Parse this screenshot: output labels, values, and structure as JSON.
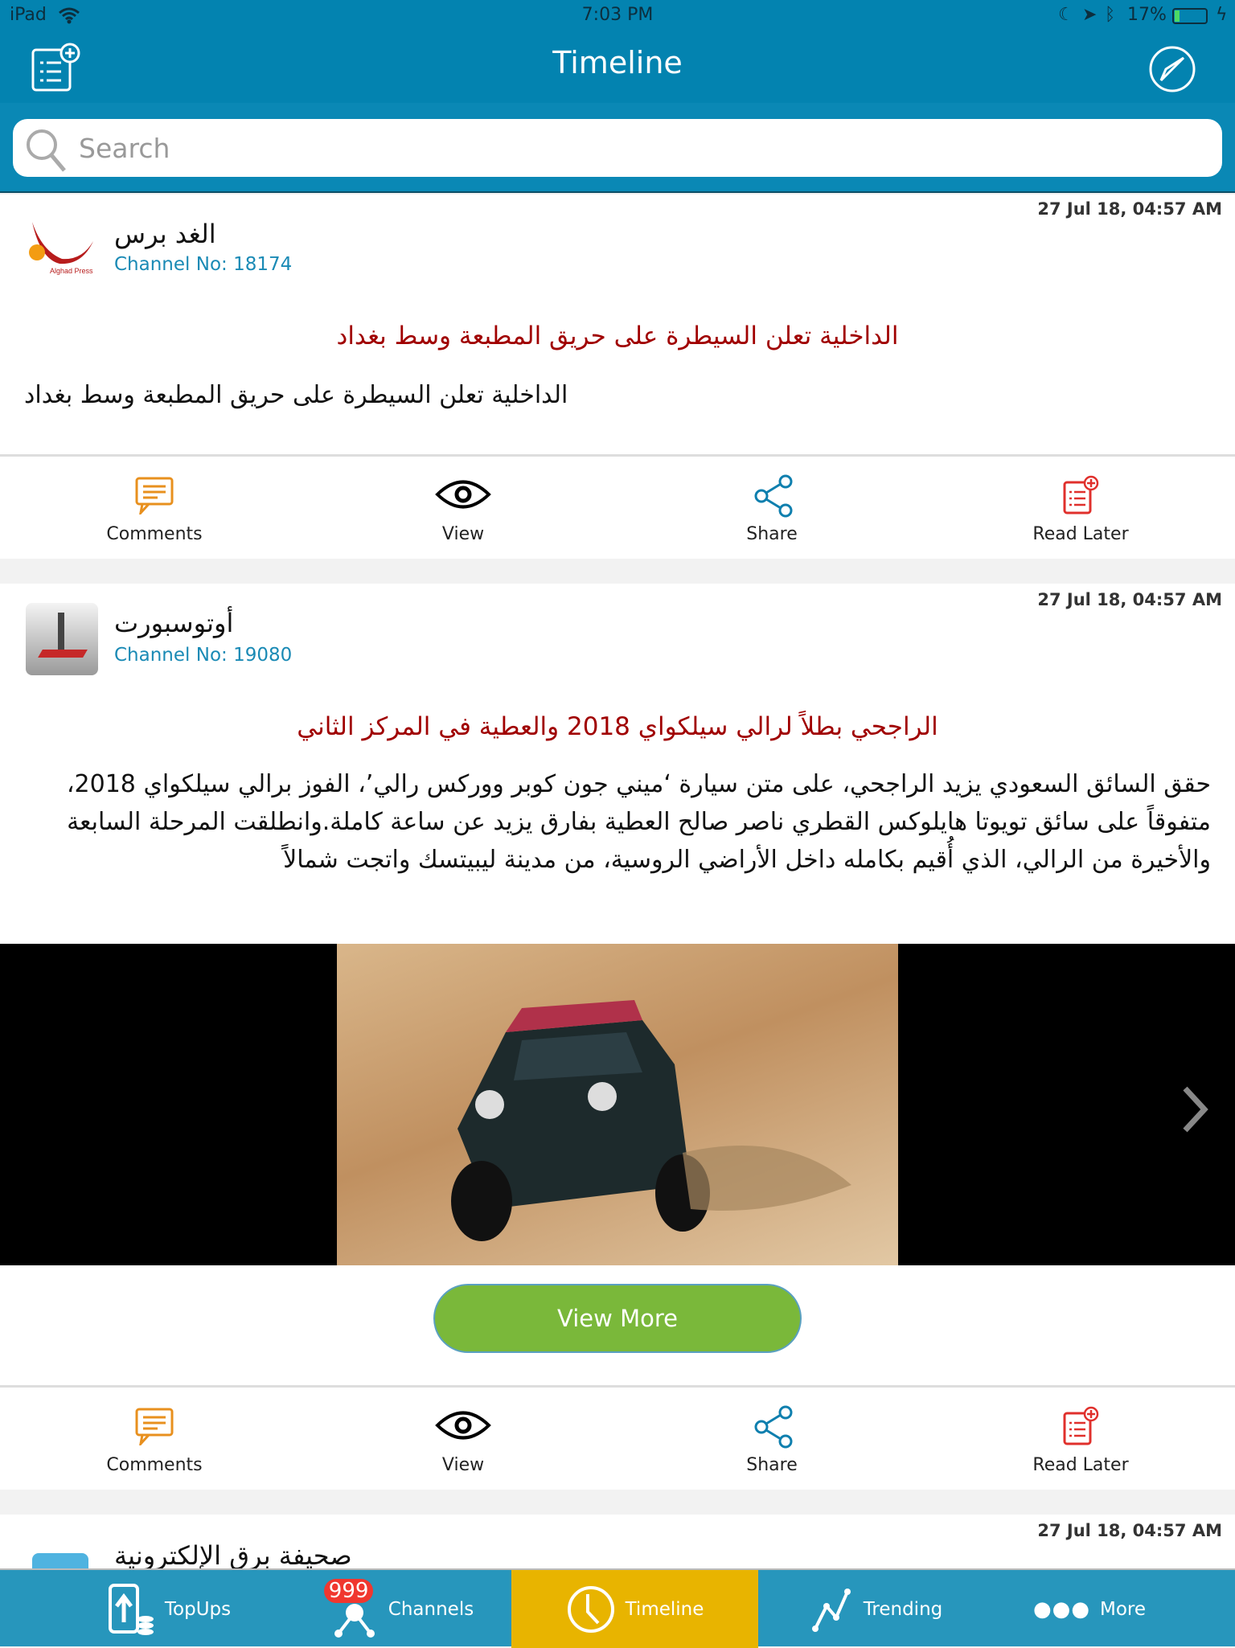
{
  "status_bar": {
    "device": "iPad",
    "time": "7:03 PM",
    "battery": "17%"
  },
  "nav": {
    "title": "Timeline",
    "left_icon": "read-later-list-icon",
    "right_icon": "compass-icon"
  },
  "search": {
    "placeholder": "Search"
  },
  "colors": {
    "nav": "#0383b0",
    "tabbar": "#2796bc",
    "active_tab": "#e8b400",
    "title_red": "#a00000",
    "channel_blue": "#1a8ab5",
    "view_more": "#7ab83a"
  },
  "posts": [
    {
      "timestamp": "27 Jul 18, 04:57 AM",
      "channel_name": "الغد برس",
      "channel_no": "Channel No: 18174",
      "logo_text": "Alghad Press",
      "title": "الداخلية تعلن السيطرة على حريق المطبعة وسط بغداد",
      "body": "الداخلية تعلن السيطرة على حريق المطبعة وسط بغداد"
    },
    {
      "timestamp": "27 Jul 18, 04:57 AM",
      "channel_name": "أوتوسبورت",
      "channel_no": "Channel No: 19080",
      "title": "الراجحي بطلاً لرالي سيلكواي 2018 والعطية في المركز الثاني",
      "body": "حقق السائق السعودي يزيد الراجحي، على متن سيارة ‘ميني جون كوبر ووركس رالي’، الفوز برالي سيلكواي 2018، متفوقاً على سائق تويوتا هايلوكس القطري ناصر صالح العطية بفارق يزيد عن ساعة كاملة.وانطلقت المرحلة السابعة والأخيرة من الرالي، الذي أُقيم بكامله داخل الأراضي الروسية، من مدينة ليبيتسك واتجت شمالاً",
      "view_more": "View More"
    },
    {
      "timestamp": "27 Jul 18, 04:57 AM",
      "channel_name": "صحيفة برق الإلكترونية"
    }
  ],
  "actions": {
    "comments": "Comments",
    "view": "View",
    "share": "Share",
    "read_later": "Read Later"
  },
  "tabs": [
    {
      "label": "TopUps"
    },
    {
      "label": "Channels",
      "badge": "999"
    },
    {
      "label": "Timeline",
      "active": true
    },
    {
      "label": "Trending"
    },
    {
      "label": "More"
    }
  ]
}
